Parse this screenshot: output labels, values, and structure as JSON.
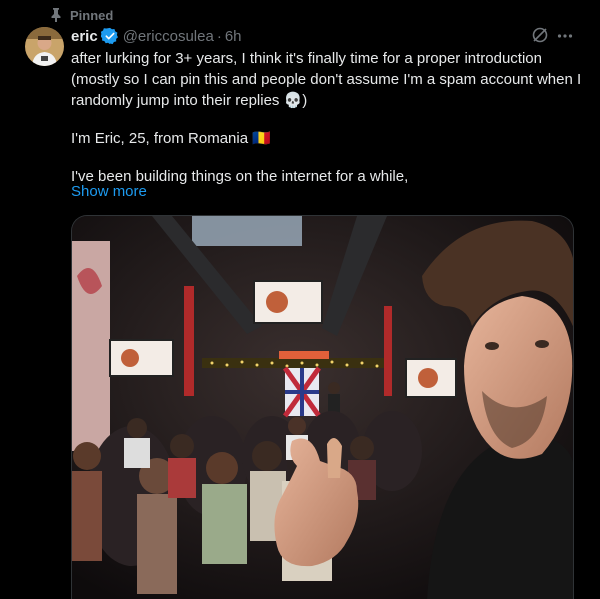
{
  "pinned": {
    "label": "Pinned",
    "icon": "pin-icon"
  },
  "author": {
    "display_name": "eric",
    "handle": "@ericcosulea",
    "separator": "·",
    "time": "6h",
    "verified_icon": "verified-badge-icon",
    "accent": "#1d9bf0"
  },
  "post": {
    "lines": [
      "after lurking for 3+ years, I think it's finally time for a proper introduction (mostly so I can pin this and people don't assume I'm a spam account when I randomly jump into their replies 💀)",
      "I'm Eric, 25, from Romania 🇷🇴",
      "I've been building things on the internet for a while,"
    ],
    "show_more": "Show more"
  },
  "media": {
    "description_icon": "photo-selfie-at-event"
  },
  "actions": {
    "grok_icon": "grok-icon",
    "more_icon": "more-icon"
  }
}
